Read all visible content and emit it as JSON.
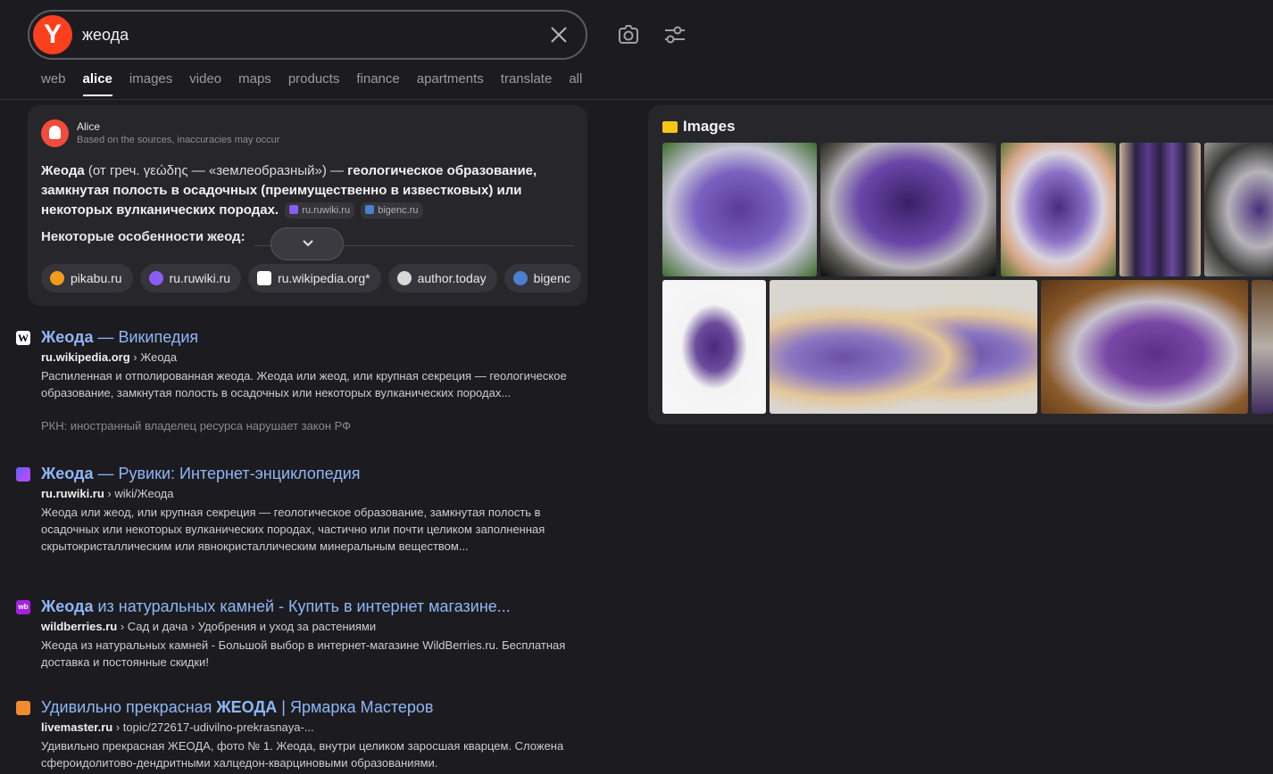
{
  "search": {
    "query": "жеода"
  },
  "tabs": [
    "web",
    "alice",
    "images",
    "video",
    "maps",
    "products",
    "finance",
    "apartments",
    "translate",
    "all"
  ],
  "active_tab": "alice",
  "alice": {
    "title": "Alice",
    "subtitle": "Based on the sources, inaccuracies may occur",
    "answer_1": "Жеода",
    "answer_2": " (от греч. γεώδης — «землеобразный») — ",
    "answer_3": "геологическое образование, замкнутая полость в осадочных (преимущественно в известковых) или некоторых вулканических породах.",
    "source_1": "ru.ruwiki.ru",
    "source_2": "bigenc.ru",
    "features": "Некоторые особенности жеод:",
    "chips": [
      "pikabu.ru",
      "ru.ruwiki.ru",
      "ru.wikipedia.org*",
      "author.today",
      "bigenc"
    ]
  },
  "results": [
    {
      "title_bold": "Жеода",
      "title_rest": " — Википедия",
      "domain": "ru.wikipedia.org",
      "path": " › Жеода",
      "snippet": "Распиленная и отполированная жеода. Жеода или жеод, или крупная секреция — геологическое образование, замкнутая полость в осадочных или некоторых вулканических породах...",
      "note": "РКН: иностранный владелец ресурса нарушает закон РФ"
    },
    {
      "title_bold": "Жеода",
      "title_rest": " — Рувики: Интернет-энциклопедия",
      "domain": "ru.ruwiki.ru",
      "path": " › wiki/Жеода",
      "snippet": "Жеода или жеод, или крупная секреция — геологическое образование, замкнутая полость в осадочных или некоторых вулканических породах, частично или почти целиком заполненная скрытокристаллическим или явнокристаллическим минеральным веществом..."
    },
    {
      "title_bold": "Жеода",
      "title_rest": " из натуральных камней - Купить в интернет магазине...",
      "domain": "wildberries.ru",
      "path": " › Сад и дача › Удобрения и уход за растениями",
      "snippet": "Жеода из натуральных камней - Большой выбор в интернет-магазине WildBerries.ru. Бесплатная доставка и постоянные скидки!"
    },
    {
      "title_pre": "Удивильно прекрасная ",
      "title_bold": "ЖЕОДА",
      "title_rest": " | Ярмарка Мастеров",
      "domain": "livemaster.ru",
      "path": " › topic/272617-udivilno-prekrasnaya-...",
      "snippet": "Удивильно прекрасная ЖЕОДА, фото № 1. Жеода, внутри целиком заросшая кварцем. Сложена сфероидолитово-дендритными халцедон-кварциновыми образованиями."
    }
  ],
  "images": {
    "heading": "Images"
  },
  "colors": {
    "background": "#1c1c20",
    "card": "#26262b",
    "link": "#8fb6f5",
    "brand": "#fc3f1d"
  },
  "icons": [
    "yandex-logo-icon",
    "clear-icon",
    "camera-search-icon",
    "filters-icon",
    "alice-icon",
    "chevron-down-icon",
    "images-icon"
  ]
}
